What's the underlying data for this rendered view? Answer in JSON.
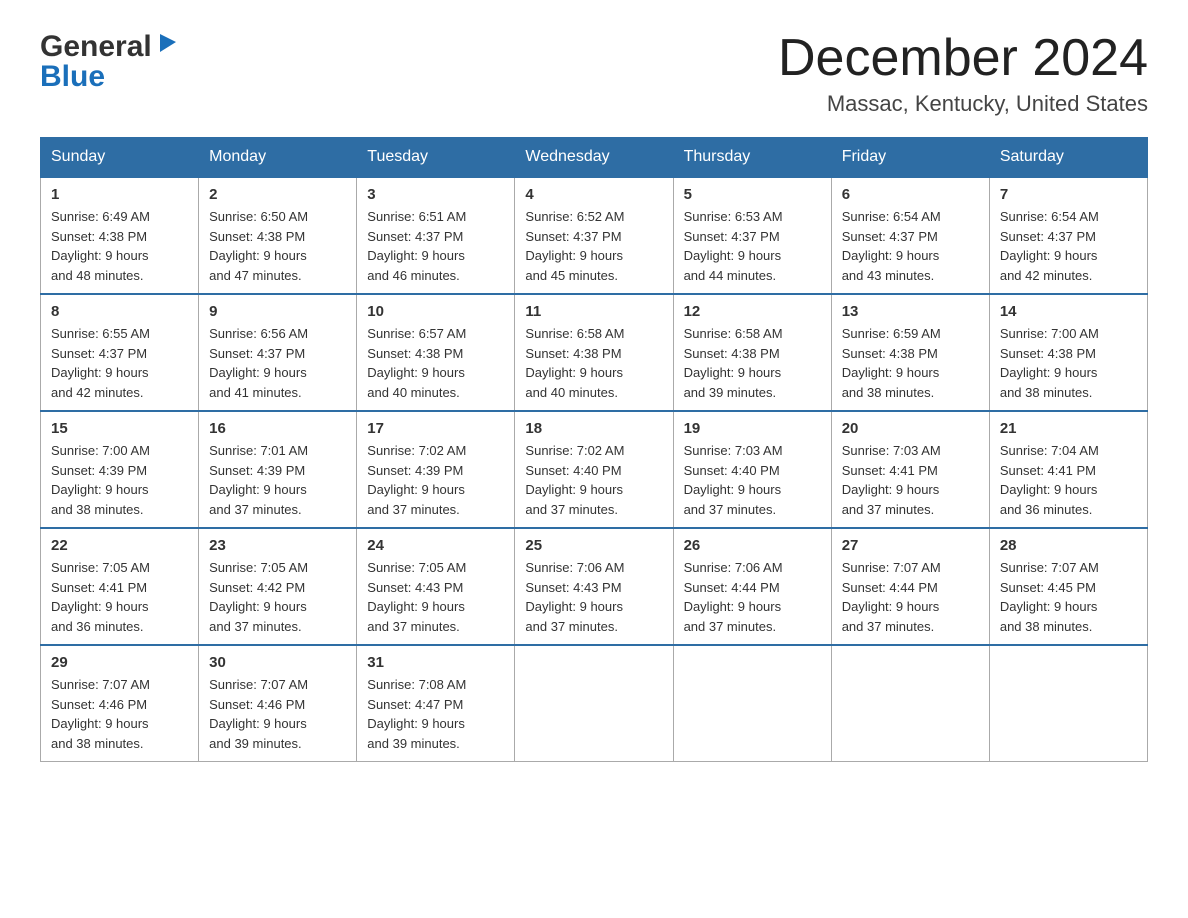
{
  "header": {
    "logo_general": "General",
    "logo_blue": "Blue",
    "month_title": "December 2024",
    "location": "Massac, Kentucky, United States"
  },
  "days_of_week": [
    "Sunday",
    "Monday",
    "Tuesday",
    "Wednesday",
    "Thursday",
    "Friday",
    "Saturday"
  ],
  "weeks": [
    [
      {
        "day": "1",
        "sunrise": "6:49 AM",
        "sunset": "4:38 PM",
        "daylight": "9 hours and 48 minutes."
      },
      {
        "day": "2",
        "sunrise": "6:50 AM",
        "sunset": "4:38 PM",
        "daylight": "9 hours and 47 minutes."
      },
      {
        "day": "3",
        "sunrise": "6:51 AM",
        "sunset": "4:37 PM",
        "daylight": "9 hours and 46 minutes."
      },
      {
        "day": "4",
        "sunrise": "6:52 AM",
        "sunset": "4:37 PM",
        "daylight": "9 hours and 45 minutes."
      },
      {
        "day": "5",
        "sunrise": "6:53 AM",
        "sunset": "4:37 PM",
        "daylight": "9 hours and 44 minutes."
      },
      {
        "day": "6",
        "sunrise": "6:54 AM",
        "sunset": "4:37 PM",
        "daylight": "9 hours and 43 minutes."
      },
      {
        "day": "7",
        "sunrise": "6:54 AM",
        "sunset": "4:37 PM",
        "daylight": "9 hours and 42 minutes."
      }
    ],
    [
      {
        "day": "8",
        "sunrise": "6:55 AM",
        "sunset": "4:37 PM",
        "daylight": "9 hours and 42 minutes."
      },
      {
        "day": "9",
        "sunrise": "6:56 AM",
        "sunset": "4:37 PM",
        "daylight": "9 hours and 41 minutes."
      },
      {
        "day": "10",
        "sunrise": "6:57 AM",
        "sunset": "4:38 PM",
        "daylight": "9 hours and 40 minutes."
      },
      {
        "day": "11",
        "sunrise": "6:58 AM",
        "sunset": "4:38 PM",
        "daylight": "9 hours and 40 minutes."
      },
      {
        "day": "12",
        "sunrise": "6:58 AM",
        "sunset": "4:38 PM",
        "daylight": "9 hours and 39 minutes."
      },
      {
        "day": "13",
        "sunrise": "6:59 AM",
        "sunset": "4:38 PM",
        "daylight": "9 hours and 38 minutes."
      },
      {
        "day": "14",
        "sunrise": "7:00 AM",
        "sunset": "4:38 PM",
        "daylight": "9 hours and 38 minutes."
      }
    ],
    [
      {
        "day": "15",
        "sunrise": "7:00 AM",
        "sunset": "4:39 PM",
        "daylight": "9 hours and 38 minutes."
      },
      {
        "day": "16",
        "sunrise": "7:01 AM",
        "sunset": "4:39 PM",
        "daylight": "9 hours and 37 minutes."
      },
      {
        "day": "17",
        "sunrise": "7:02 AM",
        "sunset": "4:39 PM",
        "daylight": "9 hours and 37 minutes."
      },
      {
        "day": "18",
        "sunrise": "7:02 AM",
        "sunset": "4:40 PM",
        "daylight": "9 hours and 37 minutes."
      },
      {
        "day": "19",
        "sunrise": "7:03 AM",
        "sunset": "4:40 PM",
        "daylight": "9 hours and 37 minutes."
      },
      {
        "day": "20",
        "sunrise": "7:03 AM",
        "sunset": "4:41 PM",
        "daylight": "9 hours and 37 minutes."
      },
      {
        "day": "21",
        "sunrise": "7:04 AM",
        "sunset": "4:41 PM",
        "daylight": "9 hours and 36 minutes."
      }
    ],
    [
      {
        "day": "22",
        "sunrise": "7:05 AM",
        "sunset": "4:41 PM",
        "daylight": "9 hours and 36 minutes."
      },
      {
        "day": "23",
        "sunrise": "7:05 AM",
        "sunset": "4:42 PM",
        "daylight": "9 hours and 37 minutes."
      },
      {
        "day": "24",
        "sunrise": "7:05 AM",
        "sunset": "4:43 PM",
        "daylight": "9 hours and 37 minutes."
      },
      {
        "day": "25",
        "sunrise": "7:06 AM",
        "sunset": "4:43 PM",
        "daylight": "9 hours and 37 minutes."
      },
      {
        "day": "26",
        "sunrise": "7:06 AM",
        "sunset": "4:44 PM",
        "daylight": "9 hours and 37 minutes."
      },
      {
        "day": "27",
        "sunrise": "7:07 AM",
        "sunset": "4:44 PM",
        "daylight": "9 hours and 37 minutes."
      },
      {
        "day": "28",
        "sunrise": "7:07 AM",
        "sunset": "4:45 PM",
        "daylight": "9 hours and 38 minutes."
      }
    ],
    [
      {
        "day": "29",
        "sunrise": "7:07 AM",
        "sunset": "4:46 PM",
        "daylight": "9 hours and 38 minutes."
      },
      {
        "day": "30",
        "sunrise": "7:07 AM",
        "sunset": "4:46 PM",
        "daylight": "9 hours and 39 minutes."
      },
      {
        "day": "31",
        "sunrise": "7:08 AM",
        "sunset": "4:47 PM",
        "daylight": "9 hours and 39 minutes."
      },
      null,
      null,
      null,
      null
    ]
  ],
  "labels": {
    "sunrise": "Sunrise:",
    "sunset": "Sunset:",
    "daylight": "Daylight:"
  }
}
